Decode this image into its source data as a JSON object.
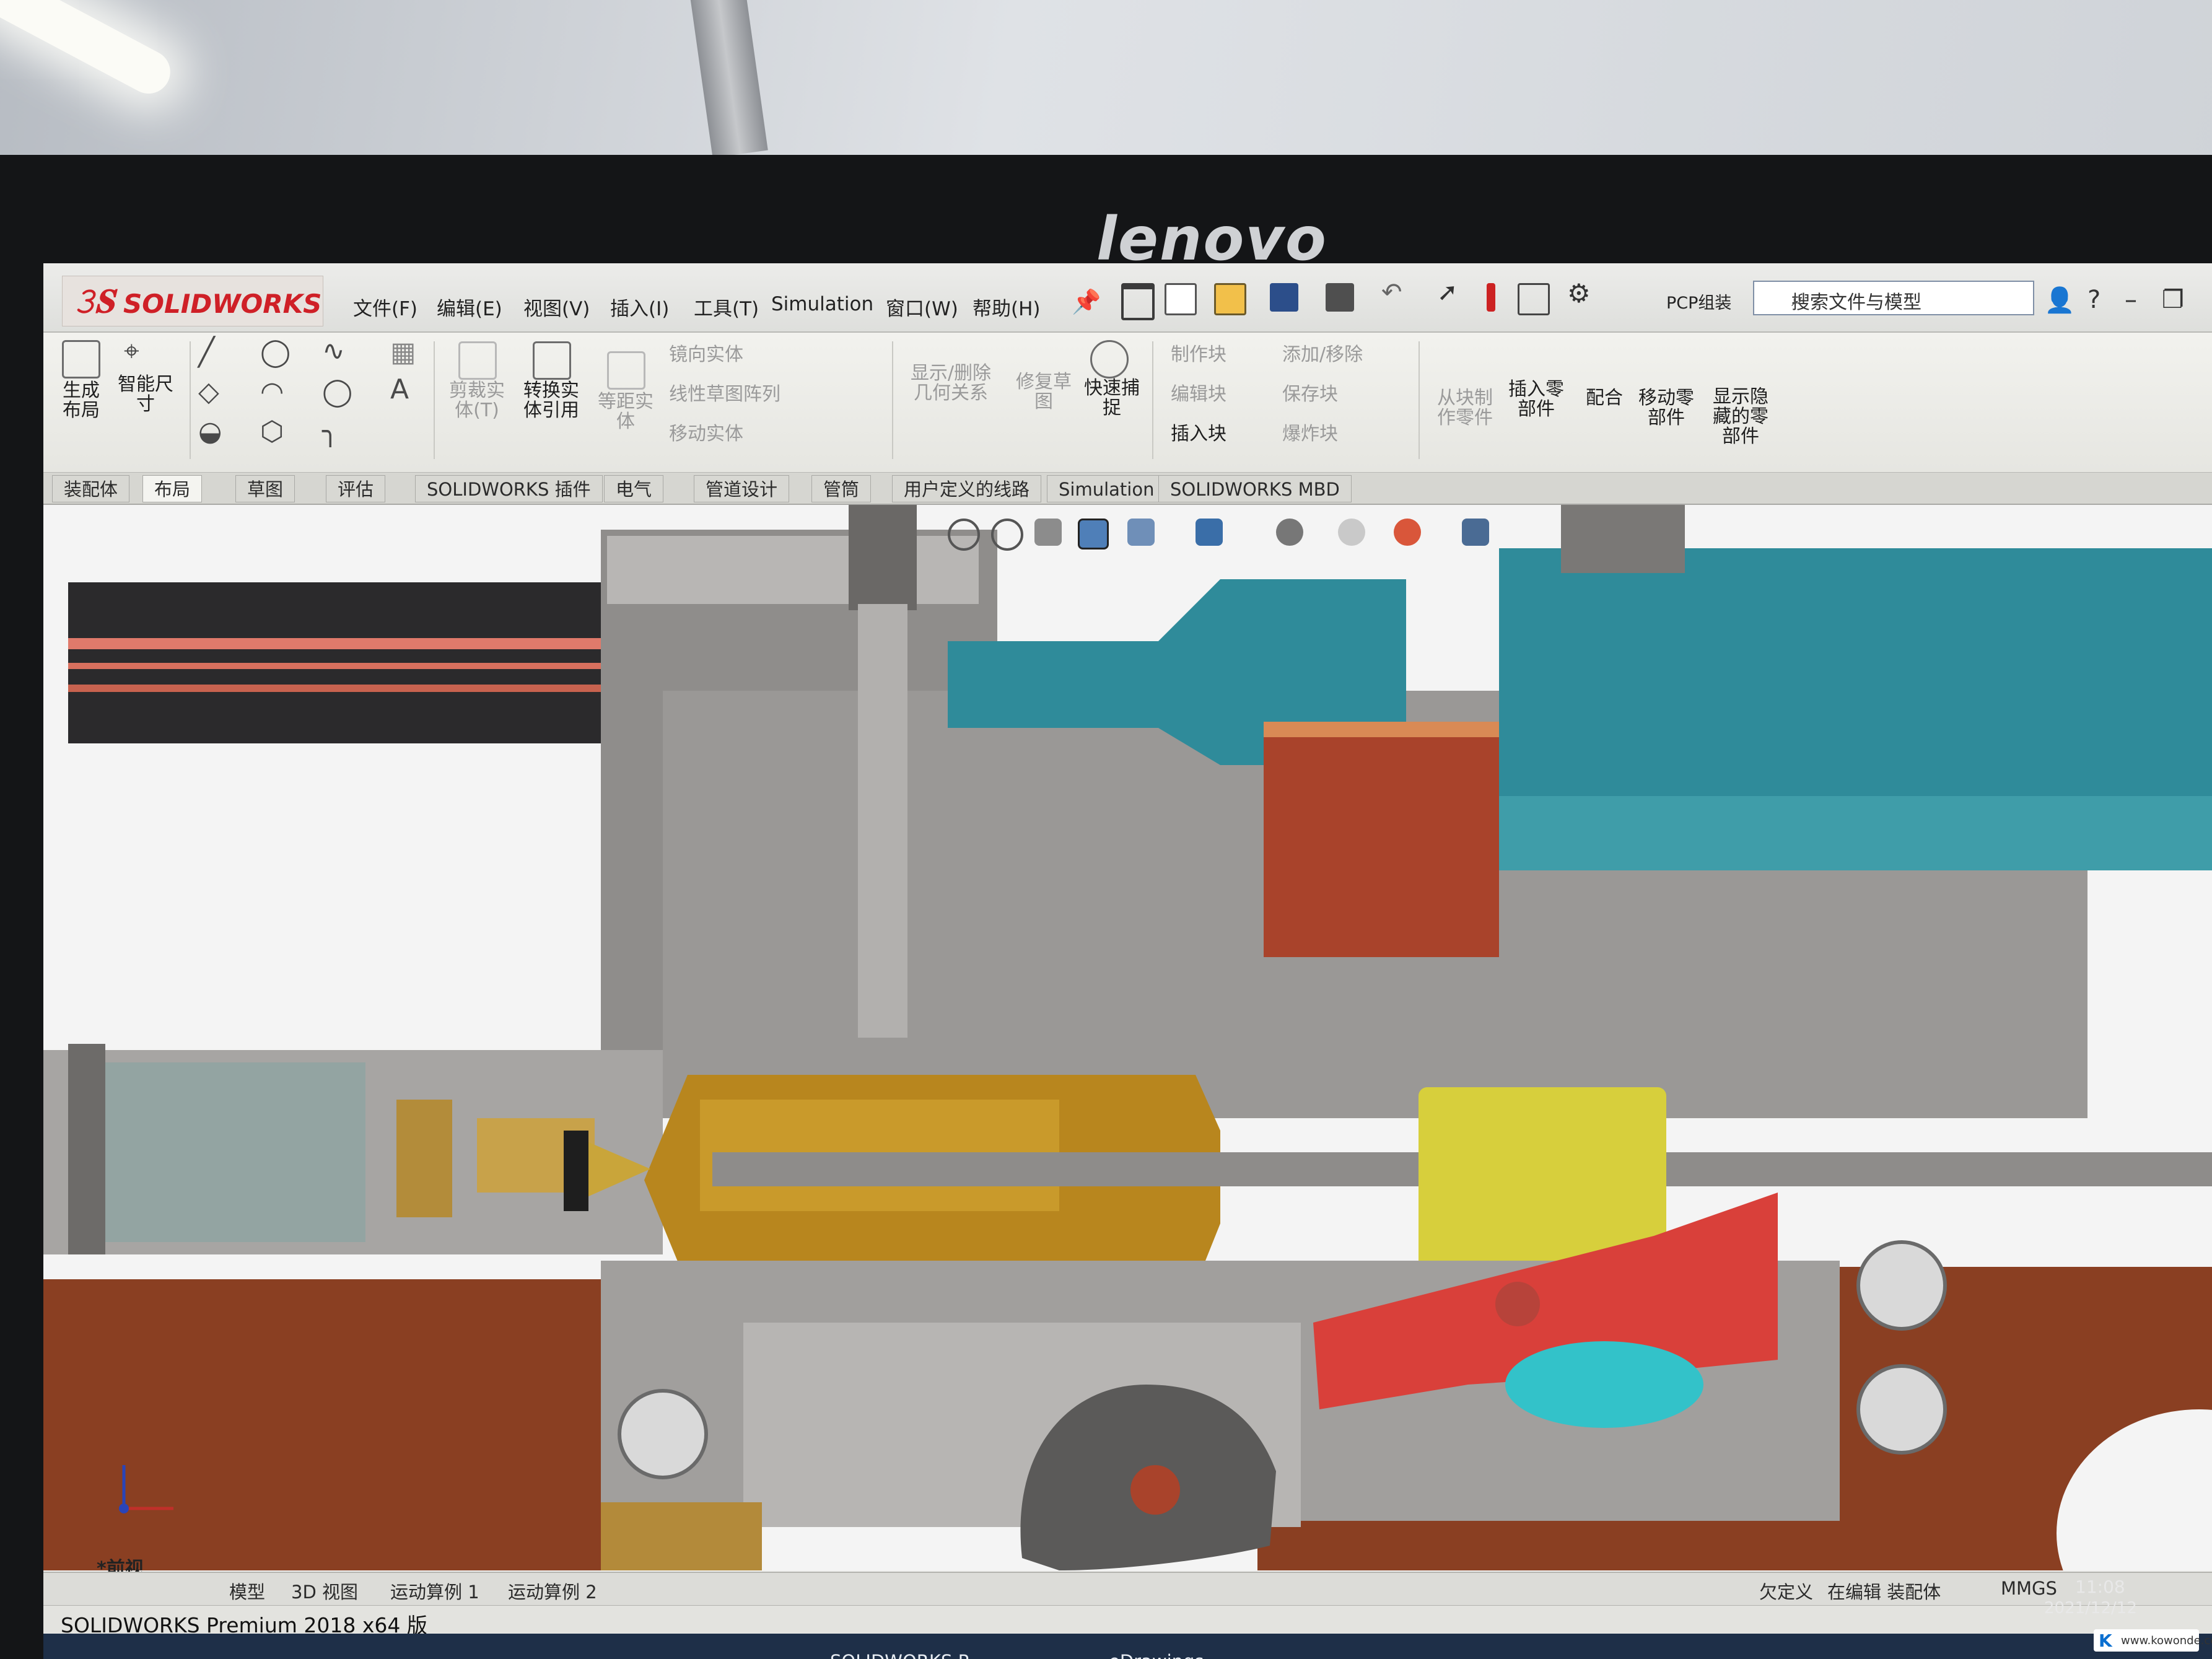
{
  "monitor": {
    "brand": "lenovo"
  },
  "app": {
    "brand": "SOLIDWORKS",
    "window_title": "SOLIDWORKS Premium 2018 x64 版"
  },
  "menu": {
    "items": [
      "文件(F)",
      "编辑(E)",
      "视图(V)",
      "插入(I)",
      "工具(T)",
      "Simulation",
      "窗口(W)",
      "帮助(H)"
    ]
  },
  "toolbar": {
    "pcp_label": "PCP组装",
    "search_placeholder": "搜索文件与模型"
  },
  "ribbon": {
    "make_layout": "生成\n布局",
    "smart_dimension": "智能尺\n寸",
    "trim_entities": "剪裁实\n体(T)",
    "convert_entities": "转换实\n体引用",
    "offset_entities": "等距实\n体",
    "mirror_entities": "镜向实体",
    "linear_pattern": "线性草图阵列",
    "move_entities": "移动实体",
    "show_relations": "显示/删除\n几何关系",
    "repair_sketch": "修复草\n图",
    "quick_snaps": "快速捕\n捉",
    "make_block": "制作块",
    "edit_block": "编辑块",
    "insert_block": "插入块",
    "add_remove": "添加/移除",
    "save_block": "保存块",
    "explode_block": "爆炸块",
    "make_part_from_block": "从块制\n作零件",
    "insert_components": "插入零\n部件",
    "mate": "配合",
    "move_component": "移动零\n部件",
    "show_hidden": "显示隐\n藏的零\n部件"
  },
  "tabs": [
    "装配体",
    "布局",
    "草图",
    "评估",
    "SOLIDWORKS 插件",
    "电气",
    "管道设计",
    "管筒",
    "用户定义的线路",
    "Simulation",
    "SOLIDWORKS MBD"
  ],
  "active_tab": "布局",
  "viewport": {
    "view_name": "*前视"
  },
  "bottom_tabs": [
    "模型",
    "3D 视图",
    "运动算例 1",
    "运动算例 2"
  ],
  "status": {
    "under_defined": "欠定义",
    "editing": "在编辑 装配体",
    "units": "MMGS"
  },
  "taskbar": {
    "sw_item": "SOLIDWORKS P...",
    "edrawings_item": "eDrawings"
  },
  "clock": {
    "time": "11:08",
    "date": "2021/12/12"
  },
  "watermark": "www.kowonde.com",
  "colors": {
    "wood": "#8a3f22",
    "brass": "#b8861e",
    "teal": "#2f8b9a",
    "yellow": "#d7cf3c",
    "red": "#d9403a",
    "cyan": "#33c2c9",
    "brand_red": "#cf2027"
  },
  "icons": [
    "home-icon",
    "new-file-icon",
    "open-file-icon",
    "save-icon",
    "print-icon",
    "undo-icon",
    "select-icon",
    "options-icon",
    "search-icon",
    "user-icon",
    "help-icon"
  ]
}
